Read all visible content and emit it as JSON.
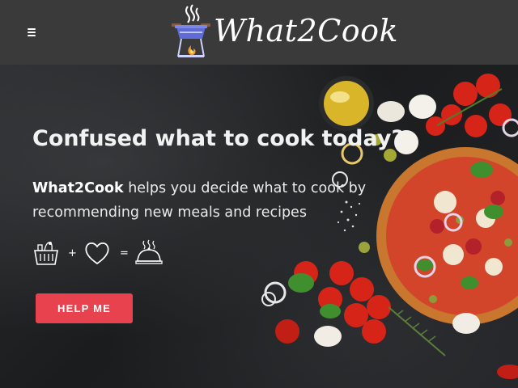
{
  "header": {
    "menu_icon": "hamburger-menu-icon",
    "logo_icon": "cooking-pot-on-fire-icon",
    "logo_text": "What2Cook"
  },
  "hero": {
    "title": "Confused what to cook today?",
    "description_brand": "What2Cook",
    "description_rest": " helps you decide what to cook by recommending new meals and recipes",
    "equation": {
      "icons": [
        "grocery-basket-icon",
        "heart-icon",
        "serving-cloche-icon"
      ],
      "plus": "+",
      "equals": "="
    },
    "cta_label": "HELP ME"
  },
  "colors": {
    "header_bg": "#3a3a3a",
    "hero_bg": "#1d1f21",
    "accent": "#e8424f",
    "text": "#f2f2f2"
  }
}
